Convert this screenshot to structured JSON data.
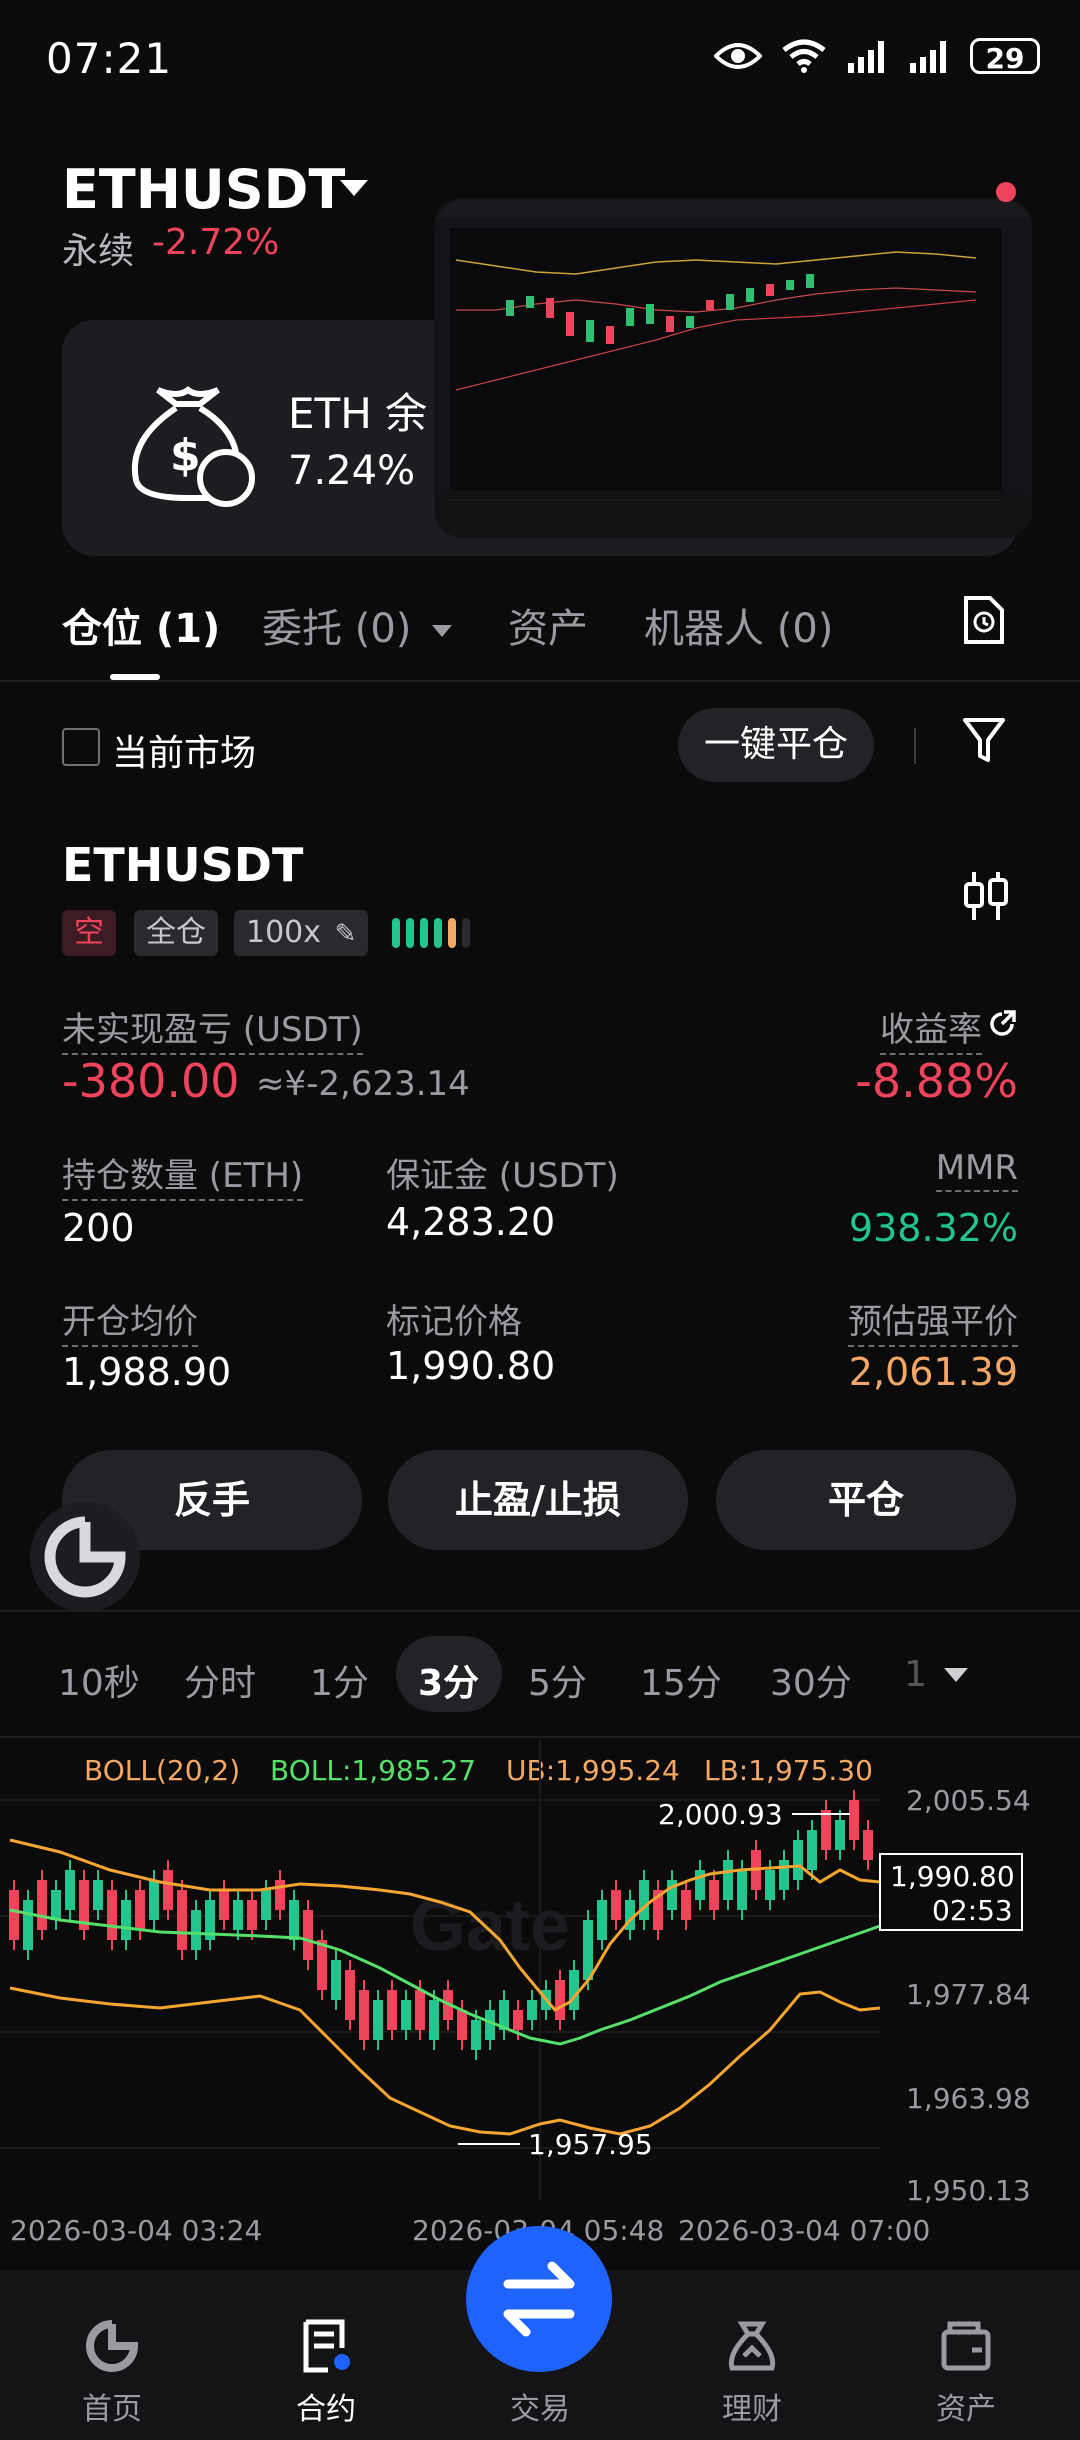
{
  "status_bar": {
    "time": "07:21",
    "battery": "29"
  },
  "header": {
    "symbol": "ETHUSDT",
    "contract_type": "永续",
    "change": "-2.72%"
  },
  "promo": {
    "title": "ETH 余",
    "value": "7.24%"
  },
  "tabs": [
    {
      "label": "仓位 (1)"
    },
    {
      "label": "委托 (0)"
    },
    {
      "label": "资产"
    },
    {
      "label": "机器人 (0)"
    }
  ],
  "filter": {
    "current_market_label": "当前市场",
    "close_all_label": "一键平仓"
  },
  "position": {
    "symbol": "ETHUSDT",
    "side": "空",
    "margin_mode": "全仓",
    "leverage": "100x",
    "unrealized_label": "未实现盈亏 (USDT)",
    "unrealized_value": "-380.00",
    "unrealized_cny": "≈¥-2,623.14",
    "roe_label": "收益率",
    "roe_value": "-8.88%",
    "qty_label": "持仓数量 (ETH)",
    "qty_value": "200",
    "margin_label": "保证金 (USDT)",
    "margin_value": "4,283.20",
    "mmr_label": "MMR",
    "mmr_value": "938.32%",
    "entry_label": "开仓均价",
    "entry_value": "1,988.90",
    "mark_label": "标记价格",
    "mark_value": "1,990.80",
    "liq_label": "预估强平价",
    "liq_value": "2,061.39"
  },
  "actions": {
    "reverse": "反手",
    "tpsl": "止盈/止损",
    "close": "平仓"
  },
  "intervals": [
    "10秒",
    "分时",
    "1分",
    "3分",
    "5分",
    "15分",
    "30分",
    "1"
  ],
  "active_interval": "3分",
  "chart": {
    "boll_params": "BOLL(20,2)",
    "boll_mid": "BOLL:1,985.27",
    "boll_ub": "UB:1,995.24",
    "boll_lb": "LB:1,975.30",
    "y_ticks": [
      "2,005.54",
      "1,977.84",
      "1,963.98",
      "1,950.13"
    ],
    "x_ticks": [
      "2026-03-04 03:24",
      "2026-03-04 05:48",
      "2026-03-04 07:00"
    ],
    "high_label": "2,000.93",
    "low_label": "1,957.95",
    "last_price": "1,990.80",
    "countdown": "02:53",
    "watermark": "Gate",
    "colors": {
      "up": "#22c58c",
      "down": "#f0445d",
      "mid": "#55e06a",
      "band": "#f7a531"
    }
  },
  "nav": [
    {
      "label": "首页"
    },
    {
      "label": "合约"
    },
    {
      "label": "交易"
    },
    {
      "label": "理财"
    },
    {
      "label": "资产"
    }
  ]
}
